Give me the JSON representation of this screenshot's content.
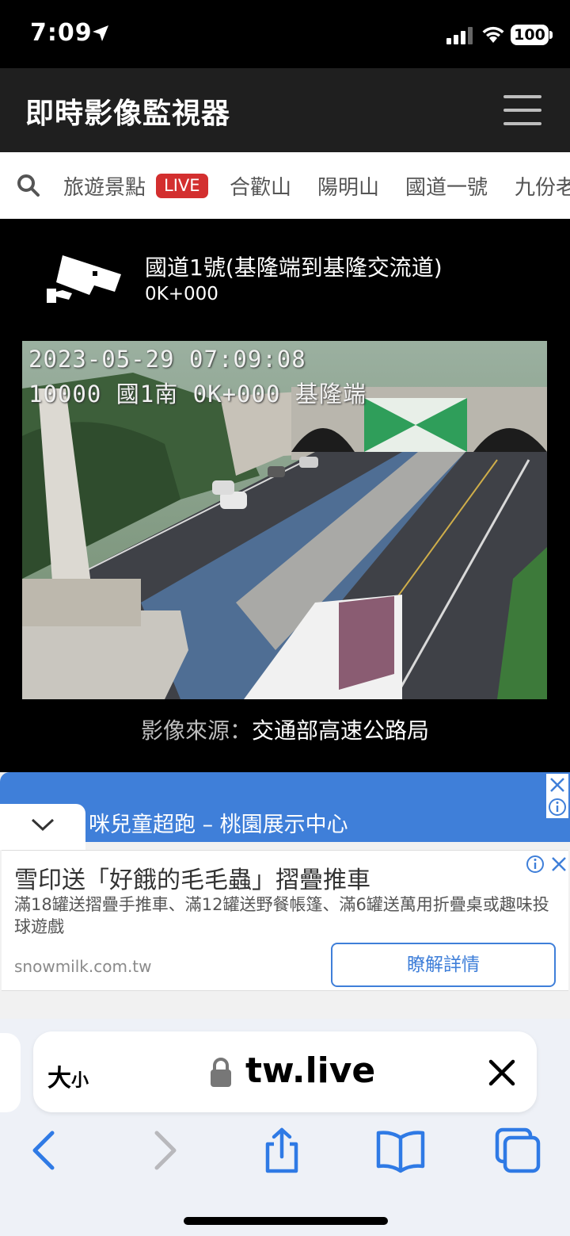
{
  "status_bar": {
    "time": "7:09",
    "battery": "100"
  },
  "app": {
    "title": "即時影像監視器"
  },
  "nav": {
    "items": [
      "旅遊景點",
      "合歡山",
      "陽明山",
      "國道一號",
      "九份老街"
    ],
    "live_badge": "LIVE"
  },
  "camera": {
    "title": "國道1號(基隆端到基隆交流道)",
    "mileage": "0K+000",
    "overlay_datetime": "2023-05-29 07:09:08",
    "overlay_info": "10000 國1南 0K+000 基隆端",
    "source_label": "影像來源：",
    "source_value": "交通部高速公路局"
  },
  "ad": {
    "banner_text": "咪兒童超跑 – 桃園展示中心",
    "headline": "雪印送「好餓的毛毛蟲」摺疊推車",
    "description": "滿18罐送摺疊手推車、滿12罐送野餐帳篷、滿6罐送萬用折疊桌或趣味投球遊戲",
    "domain": "snowmilk.com.tw",
    "cta": "瞭解詳情"
  },
  "browser": {
    "size_label": "大",
    "size_small": "小",
    "url": "tw.live"
  },
  "colors": {
    "live_red": "#d32f2f",
    "ad_blue": "#3f7fd9",
    "header_dark": "#1f1f1f"
  }
}
